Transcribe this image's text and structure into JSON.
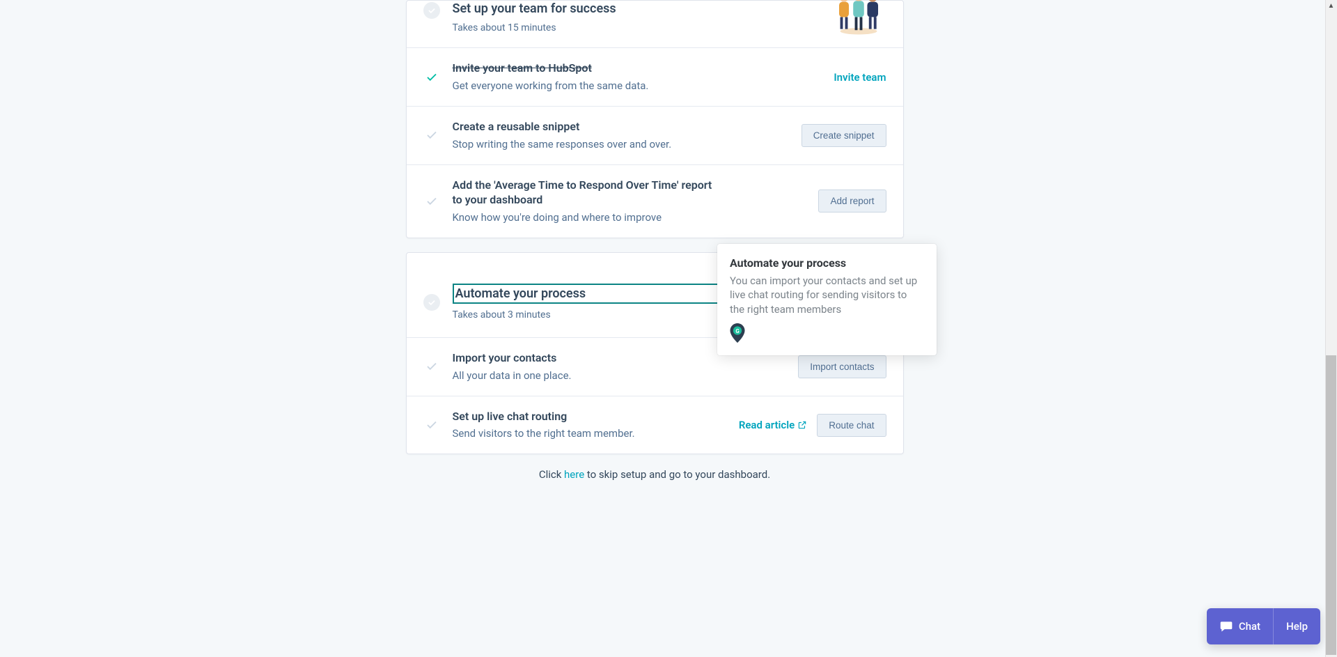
{
  "sections": {
    "team": {
      "title": "Set up your team for success",
      "duration": "Takes about 15 minutes",
      "rows": {
        "invite": {
          "title": "Invite your team to HubSpot",
          "desc": "Get everyone working from the same data.",
          "action_link": "Invite team"
        },
        "snippet": {
          "title": "Create a reusable snippet",
          "desc": "Stop writing the same responses over and over.",
          "button": "Create snippet"
        },
        "report": {
          "title": "Add the 'Average Time to Respond Over Time' report to your dashboard",
          "desc": "Know how you're doing and where to improve",
          "button": "Add report"
        }
      }
    },
    "automate": {
      "title": "Automate your process",
      "duration": "Takes about 3 minutes",
      "rows": {
        "import": {
          "title": "Import your contacts",
          "desc": "All your data in one place.",
          "button": "Import contacts"
        },
        "routing": {
          "title": "Set up live chat routing",
          "desc": "Send visitors to the right team member.",
          "link": "Read article",
          "button": "Route chat"
        }
      }
    }
  },
  "tooltip": {
    "title": "Automate your process",
    "body": "You can import your contacts and set up live chat routing for sending visitors to the right team members"
  },
  "skip": {
    "prefix": "Click ",
    "link": "here",
    "suffix": " to skip setup and go to your dashboard."
  },
  "widget": {
    "chat": "Chat",
    "help": "Help"
  }
}
